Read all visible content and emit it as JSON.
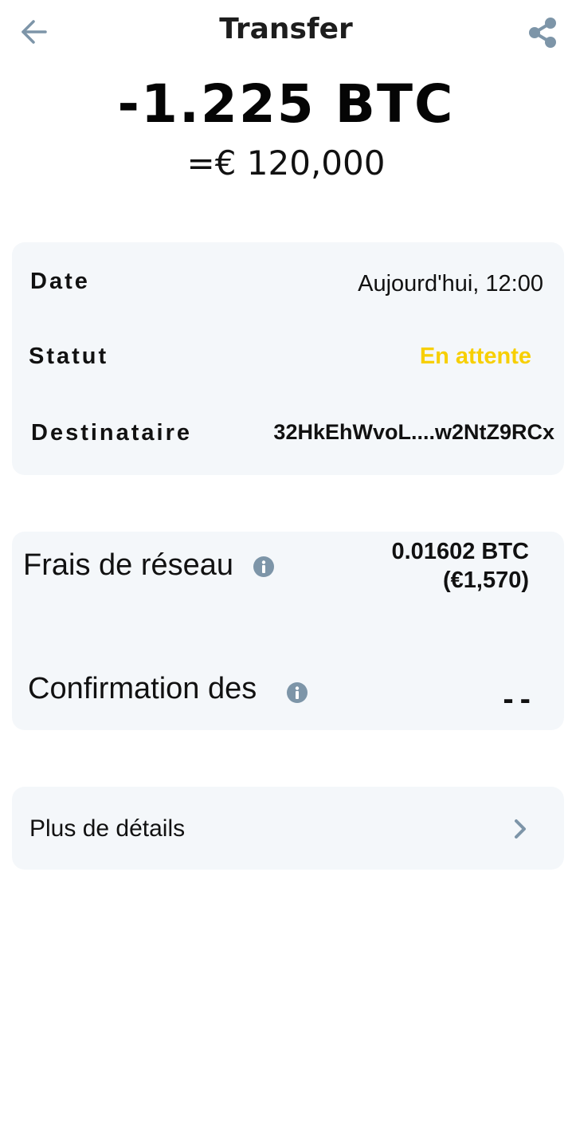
{
  "header": {
    "title": "Transfer",
    "back_icon": "arrow-left-icon",
    "share_icon": "share-icon"
  },
  "transaction": {
    "amount": "-1.225 BTC",
    "fiat_equivalent": "=€ 120,000"
  },
  "details": {
    "date_label": "Date",
    "date_value": "Aujourd'hui, 12:00",
    "status_label": "Statut",
    "status_value": "En attente",
    "recipient_label": "Destinataire",
    "recipient_value": "32HkEhWvoL....w2NtZ9RCx"
  },
  "fees": {
    "network_fee_label": "Frais de réseau",
    "network_fee_btc": "0.01602 BTC",
    "network_fee_fiat": "(€1,570)",
    "confirmation_label": "Confirmation des",
    "confirmation_value": "--"
  },
  "more": {
    "label": "Plus de détails"
  },
  "colors": {
    "background": "#ffffff",
    "card_background": "#f4f7fa",
    "status_pending": "#f7cf02",
    "icon_gray": "#7d95a8"
  }
}
